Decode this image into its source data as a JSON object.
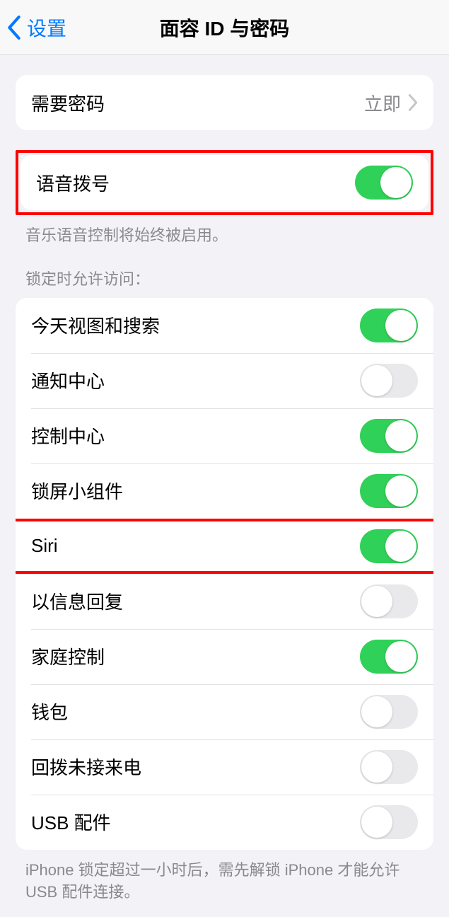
{
  "nav": {
    "back_label": "设置",
    "title": "面容 ID 与密码"
  },
  "passcode": {
    "label": "需要密码",
    "value": "立即"
  },
  "voice_dial": {
    "label": "语音拨号",
    "on": true,
    "footer": "音乐语音控制将始终被启用。"
  },
  "lock_access": {
    "header": "锁定时允许访问：",
    "items": [
      {
        "label": "今天视图和搜索",
        "on": true,
        "name": "today-view-toggle"
      },
      {
        "label": "通知中心",
        "on": false,
        "name": "notification-center-toggle"
      },
      {
        "label": "控制中心",
        "on": true,
        "name": "control-center-toggle"
      },
      {
        "label": "锁屏小组件",
        "on": true,
        "name": "lockscreen-widgets-toggle"
      },
      {
        "label": "Siri",
        "on": true,
        "name": "siri-toggle",
        "highlighted": true
      },
      {
        "label": "以信息回复",
        "on": false,
        "name": "reply-message-toggle"
      },
      {
        "label": "家庭控制",
        "on": true,
        "name": "home-control-toggle"
      },
      {
        "label": "钱包",
        "on": false,
        "name": "wallet-toggle"
      },
      {
        "label": "回拨未接来电",
        "on": false,
        "name": "return-calls-toggle"
      },
      {
        "label": "USB 配件",
        "on": false,
        "name": "usb-accessories-toggle"
      }
    ],
    "footer": "iPhone 锁定超过一小时后，需先解锁 iPhone 才能允许 USB 配件连接。"
  }
}
